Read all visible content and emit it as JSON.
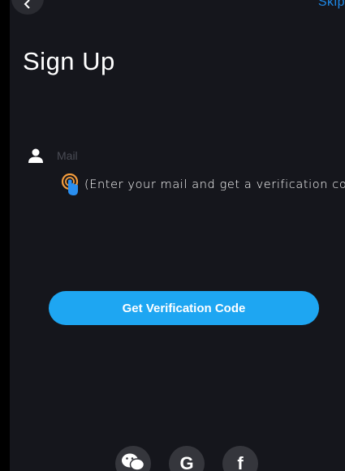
{
  "header": {
    "back_icon": "chevron-left-icon",
    "top_right_link": "Skip"
  },
  "page": {
    "title": "Sign Up"
  },
  "form": {
    "mail_placeholder": "Mail",
    "mail_value": "",
    "mail_icon": "user-icon",
    "hint_icon": "tap-finger-icon",
    "hint_text": "(Enter your mail and get a verification code)",
    "submit_label": "Get Verification Code"
  },
  "social": {
    "wechat_icon": "wechat-icon",
    "google_label": "G",
    "facebook_label": "f"
  },
  "colors": {
    "background": "#15161c",
    "accent": "#1ea6f2",
    "link": "#1e88e5",
    "hint_icon": "#f39c3c"
  }
}
